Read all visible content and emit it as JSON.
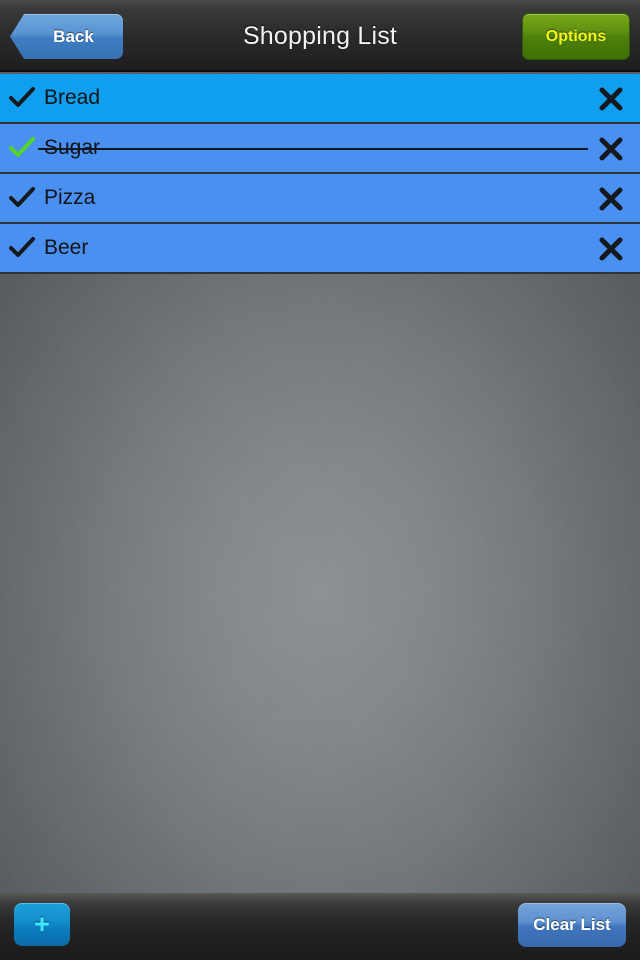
{
  "navbar": {
    "title": "Shopping List",
    "back_label": "Back",
    "options_label": "Options"
  },
  "list": {
    "items": [
      {
        "label": "Bread",
        "checked": false,
        "struck": false,
        "highlighted": true,
        "check_color": "#15191f",
        "delete_label": "✕"
      },
      {
        "label": "Sugar",
        "checked": true,
        "struck": true,
        "highlighted": false,
        "check_color": "#56d22a",
        "delete_label": "✕"
      },
      {
        "label": "Pizza",
        "checked": false,
        "struck": false,
        "highlighted": false,
        "check_color": "#15191f",
        "delete_label": "✕"
      },
      {
        "label": "Beer",
        "checked": false,
        "struck": false,
        "highlighted": false,
        "check_color": "#15191f",
        "delete_label": "✕"
      }
    ]
  },
  "toolbar": {
    "add_label": "+",
    "clear_label": "Clear List"
  },
  "colors": {
    "row_highlight": "#109fee",
    "row_normal": "#4a90f0",
    "check_green": "#56d22a",
    "check_dark": "#15191f",
    "options_green": "#5e8f10",
    "options_text": "#f4f51c",
    "accent_blue": "#3f7dc2",
    "plus_cyan": "#3ee7ff"
  }
}
